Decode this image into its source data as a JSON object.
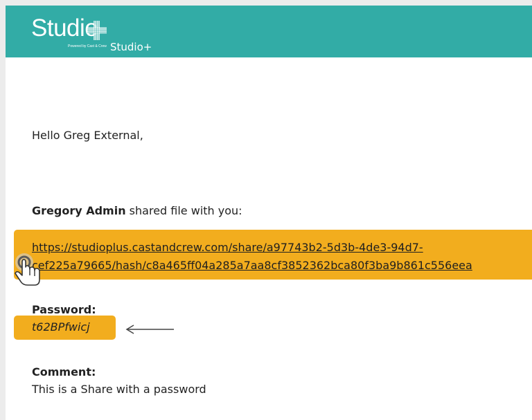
{
  "header": {
    "logo_text": "Studio",
    "logo_tagline": "Powered by Cast & Crew",
    "title": "Studio+",
    "bg_color": "#32aca6"
  },
  "email": {
    "greeting": "Hello Greg External,",
    "sender_name": "Gregory Admin",
    "shared_text": " shared file with you:",
    "link_line1": "https://studioplus.castandcrew.com/share/a97743b2-5d3b-4de3-94d7-",
    "link_line2": "cef225a79665/hash/c8a465ff04a285a7aa8cf3852362bca80f3ba9b861c556eea",
    "password_label": "Password:",
    "password_value": "t62BPfwicj",
    "comment_label": "Comment:",
    "comment_text": "This is a Share with a password"
  },
  "highlight_color": "#f2ad1e",
  "icons": {
    "pointer": "hand-pointer-icon",
    "arrow": "arrow-left-icon"
  }
}
